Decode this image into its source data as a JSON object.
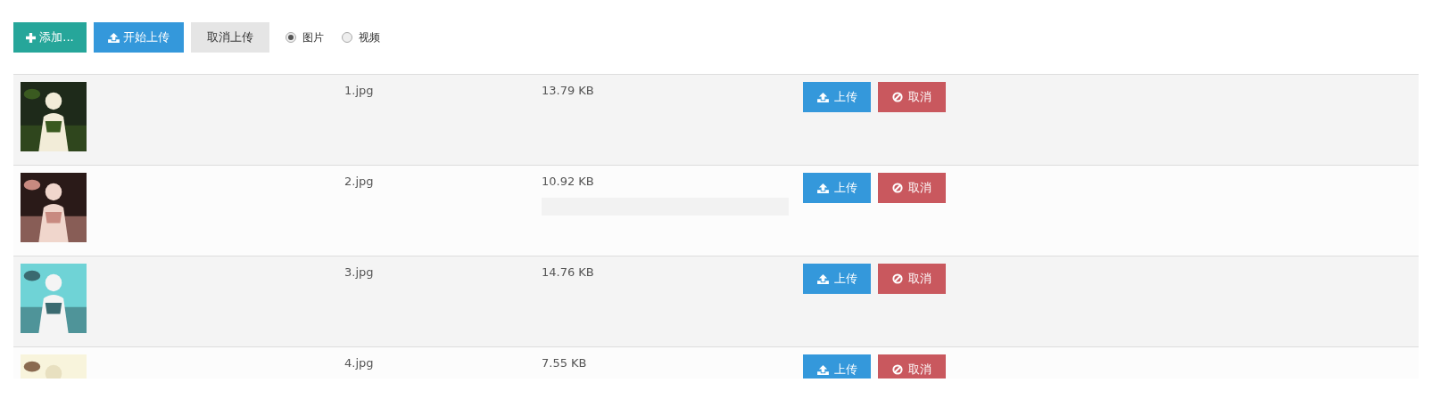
{
  "toolbar": {
    "buttons": [
      {
        "kind": "add",
        "label": "添加..."
      },
      {
        "kind": "start",
        "label": "开始上传"
      },
      {
        "kind": "cancel",
        "label": "取消上传"
      }
    ],
    "media_type": [
      {
        "label": "图片",
        "selected": true
      },
      {
        "label": "视频",
        "selected": false
      }
    ]
  },
  "files": [
    {
      "name": "1.jpg",
      "size": "13.79 KB",
      "upload": "上传",
      "cancel": "取消"
    },
    {
      "name": "2.jpg",
      "size": "10.92 KB",
      "progress": {
        "level": 0
      },
      "upload": "上传",
      "cancel": "取消"
    },
    {
      "name": "3.jpg",
      "size": "14.76 KB",
      "upload": "上传",
      "cancel": "取消"
    },
    {
      "name": "4.jpg",
      "size": "7.55 KB",
      "upload": "上传",
      "cancel": "取消"
    }
  ]
}
